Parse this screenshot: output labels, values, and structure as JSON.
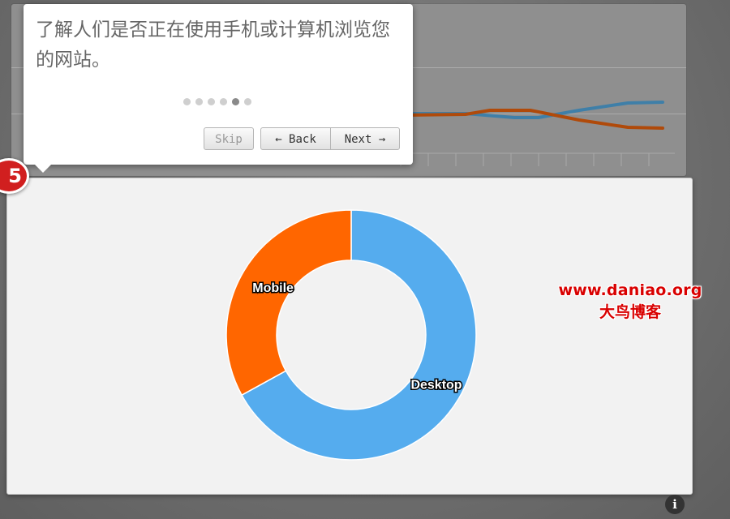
{
  "tour": {
    "text": "了解人们是否正在使用手机或计算机浏览您的网站。",
    "step_number": "5",
    "total_steps": 6,
    "current_step": 5,
    "buttons": {
      "skip": "Skip",
      "back": "← Back",
      "next": "Next →"
    }
  },
  "watermark": {
    "url": "www.daniao.org",
    "chinese": "大鸟博客"
  },
  "colors": {
    "mobile": "#ff6600",
    "desktop": "#55acee",
    "badge": "#d11f1f",
    "bg_line_blue": "#3f7fa8",
    "bg_line_orange": "#b04a0a"
  },
  "chart_data": {
    "type": "pie",
    "donut": true,
    "categories": [
      "Mobile",
      "Desktop"
    ],
    "values": [
      33,
      67
    ],
    "labels": [
      "Mobile",
      "Desktop"
    ]
  },
  "icons": {
    "info": "info-icon"
  }
}
